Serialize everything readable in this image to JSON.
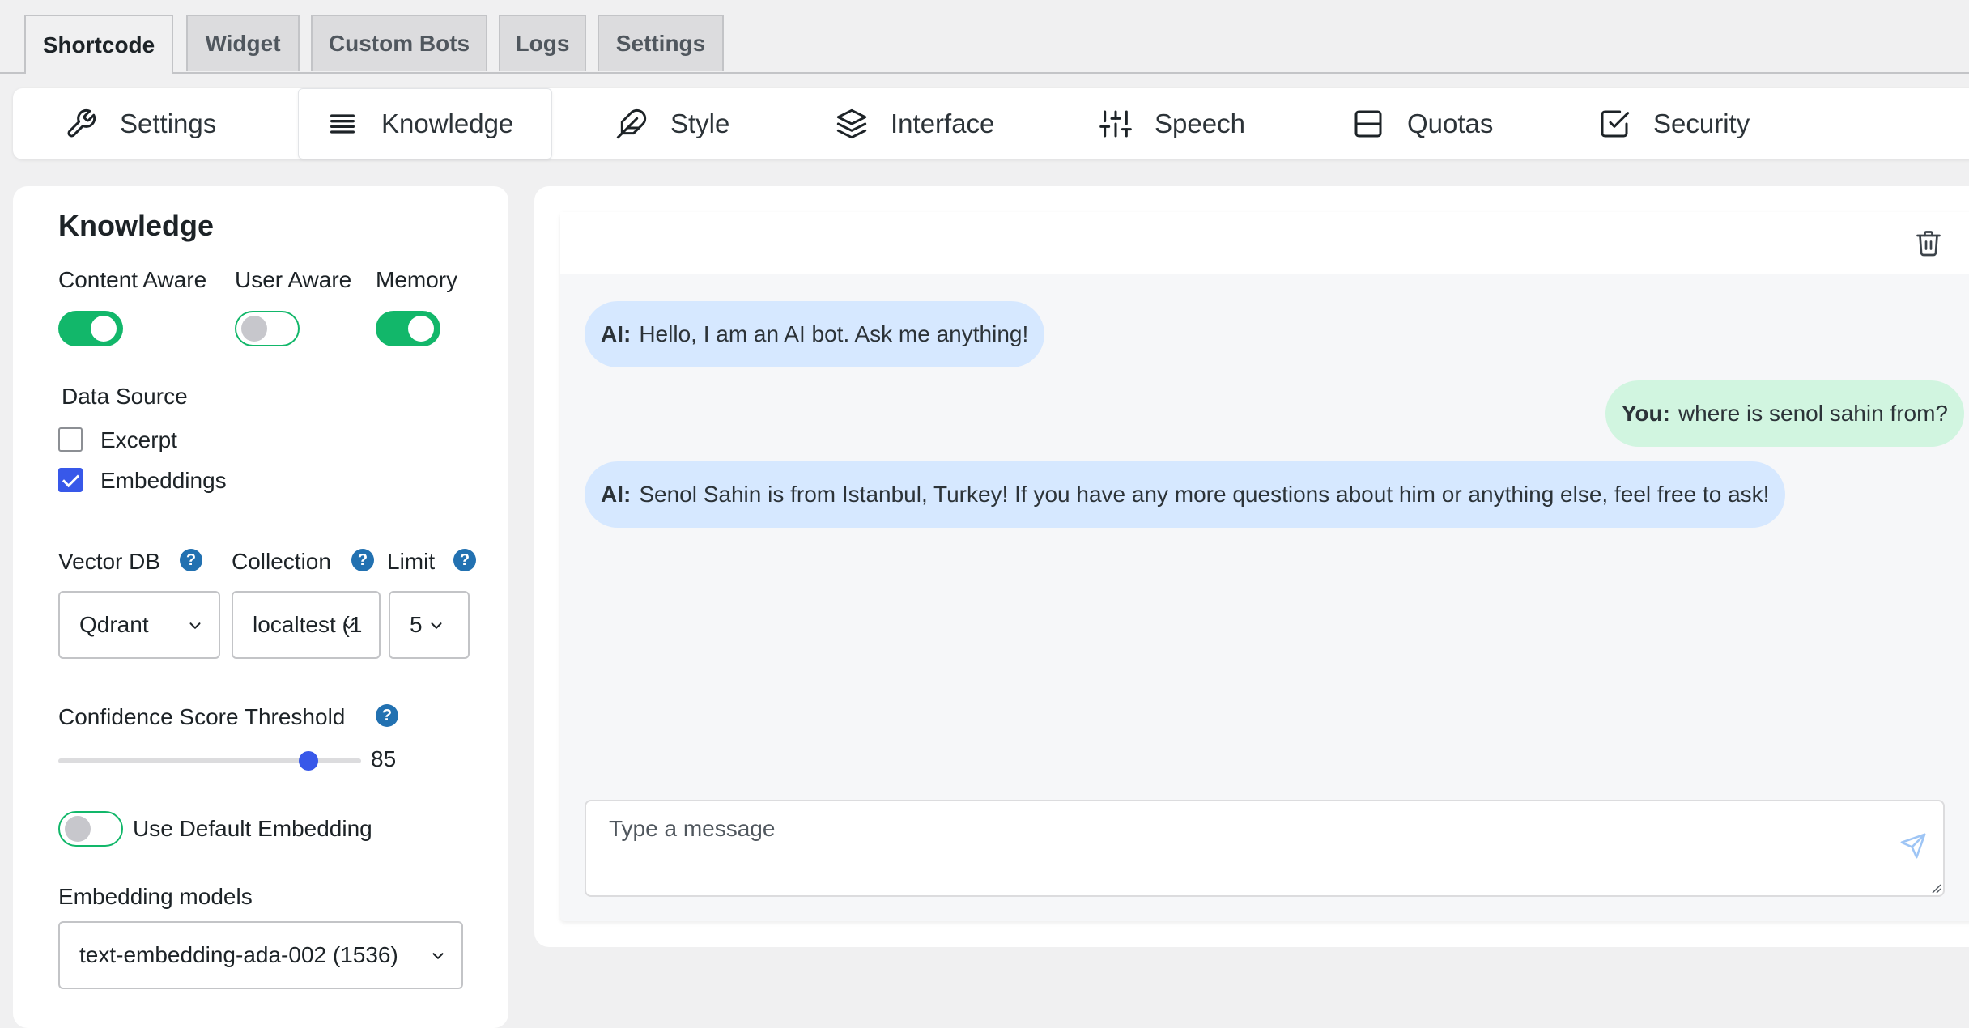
{
  "top_tabs": [
    "Shortcode",
    "Widget",
    "Custom Bots",
    "Logs",
    "Settings"
  ],
  "subnav": [
    {
      "label": "Settings",
      "icon": "wrench-icon"
    },
    {
      "label": "Knowledge",
      "icon": "list-icon"
    },
    {
      "label": "Style",
      "icon": "feather-icon"
    },
    {
      "label": "Interface",
      "icon": "layers-icon"
    },
    {
      "label": "Speech",
      "icon": "sliders-icon"
    },
    {
      "label": "Quotas",
      "icon": "panel-icon"
    },
    {
      "label": "Security",
      "icon": "check-square-icon"
    }
  ],
  "knowledge": {
    "title": "Knowledge",
    "toggles": [
      {
        "label": "Content Aware",
        "on": true
      },
      {
        "label": "User Aware",
        "on": false
      },
      {
        "label": "Memory",
        "on": true
      }
    ],
    "data_source": {
      "label": "Data Source",
      "options": [
        {
          "label": "Excerpt",
          "checked": false
        },
        {
          "label": "Embeddings",
          "checked": true
        }
      ]
    },
    "vector_db": {
      "label": "Vector DB",
      "value": "Qdrant"
    },
    "collection": {
      "label": "Collection",
      "value": "localtest (1"
    },
    "limit": {
      "label": "Limit",
      "value": "5"
    },
    "help_glyph": "?",
    "confidence": {
      "label": "Confidence Score Threshold",
      "value": "85",
      "fraction": 0.85
    },
    "use_default_embedding": {
      "label": "Use Default Embedding",
      "on": false
    },
    "embedding_models": {
      "label": "Embedding models",
      "value": "text-embedding-ada-002 (1536)"
    }
  },
  "chat": {
    "messages": [
      {
        "role": "ai",
        "who": "AI:",
        "text": "Hello, I am an AI bot. Ask me anything!"
      },
      {
        "role": "user",
        "who": "You:",
        "text": "where is senol sahin from?"
      },
      {
        "role": "ai",
        "who": "AI:",
        "text": "Senol Sahin is from Istanbul, Turkey! If you have any more questions about him or anything else, feel free to ask!"
      }
    ],
    "input_placeholder": "Type a message"
  },
  "colors": {
    "accent_green": "#12b76a",
    "accent_blue": "#3858e9",
    "help_blue": "#2271b1",
    "ai_bubble": "#d6e8ff",
    "user_bubble": "#d1f5e0"
  }
}
